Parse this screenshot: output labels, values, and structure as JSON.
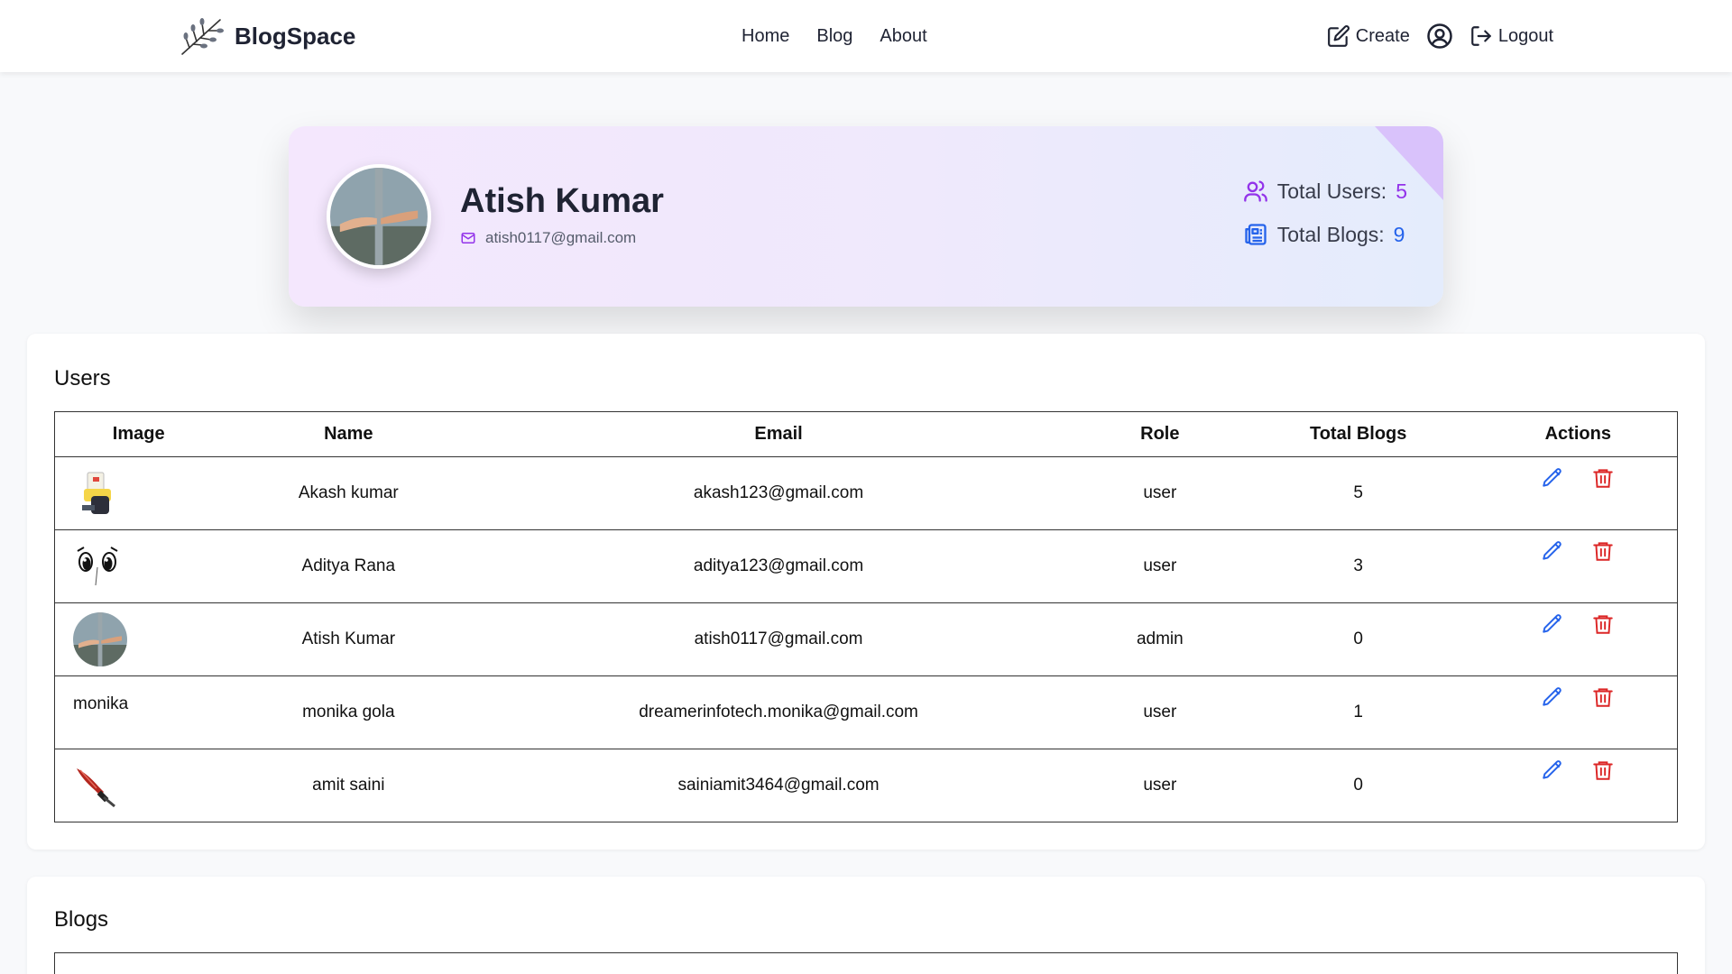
{
  "nav": {
    "brand": "BlogSpace",
    "links": [
      "Home",
      "Blog",
      "About"
    ],
    "create_label": "Create",
    "logout_label": "Logout"
  },
  "profile": {
    "name": "Atish Kumar",
    "email": "atish0117@gmail.com",
    "total_users_label": "Total Users:",
    "total_users_value": "5",
    "total_blogs_label": "Total Blogs:",
    "total_blogs_value": "9"
  },
  "users": {
    "title": "Users",
    "columns": [
      "Image",
      "Name",
      "Email",
      "Role",
      "Total Blogs",
      "Actions"
    ],
    "rows": [
      {
        "image": "printer-icon",
        "image_alt": "",
        "name": "Akash kumar",
        "email": "akash123@gmail.com",
        "role": "user",
        "total_blogs": "5"
      },
      {
        "image": "anime-eyes-icon",
        "image_alt": "",
        "name": "Aditya Rana",
        "email": "aditya123@gmail.com",
        "role": "user",
        "total_blogs": "3"
      },
      {
        "image": "avatar-photo",
        "image_alt": "",
        "name": "Atish Kumar",
        "email": "atish0117@gmail.com",
        "role": "admin",
        "total_blogs": "0"
      },
      {
        "image": "",
        "image_alt": "monika",
        "name": "monika gola",
        "email": "dreamerinfotech.monika@gmail.com",
        "role": "user",
        "total_blogs": "1"
      },
      {
        "image": "sword-icon",
        "image_alt": "",
        "name": "amit saini",
        "email": "sainiamit3464@gmail.com",
        "role": "user",
        "total_blogs": "0"
      }
    ]
  },
  "blogs": {
    "title": "Blogs"
  },
  "colors": {
    "accent_purple": "#9333ea",
    "accent_blue": "#2563eb",
    "delete_red": "#dc2626",
    "edit_blue": "#2563eb"
  }
}
